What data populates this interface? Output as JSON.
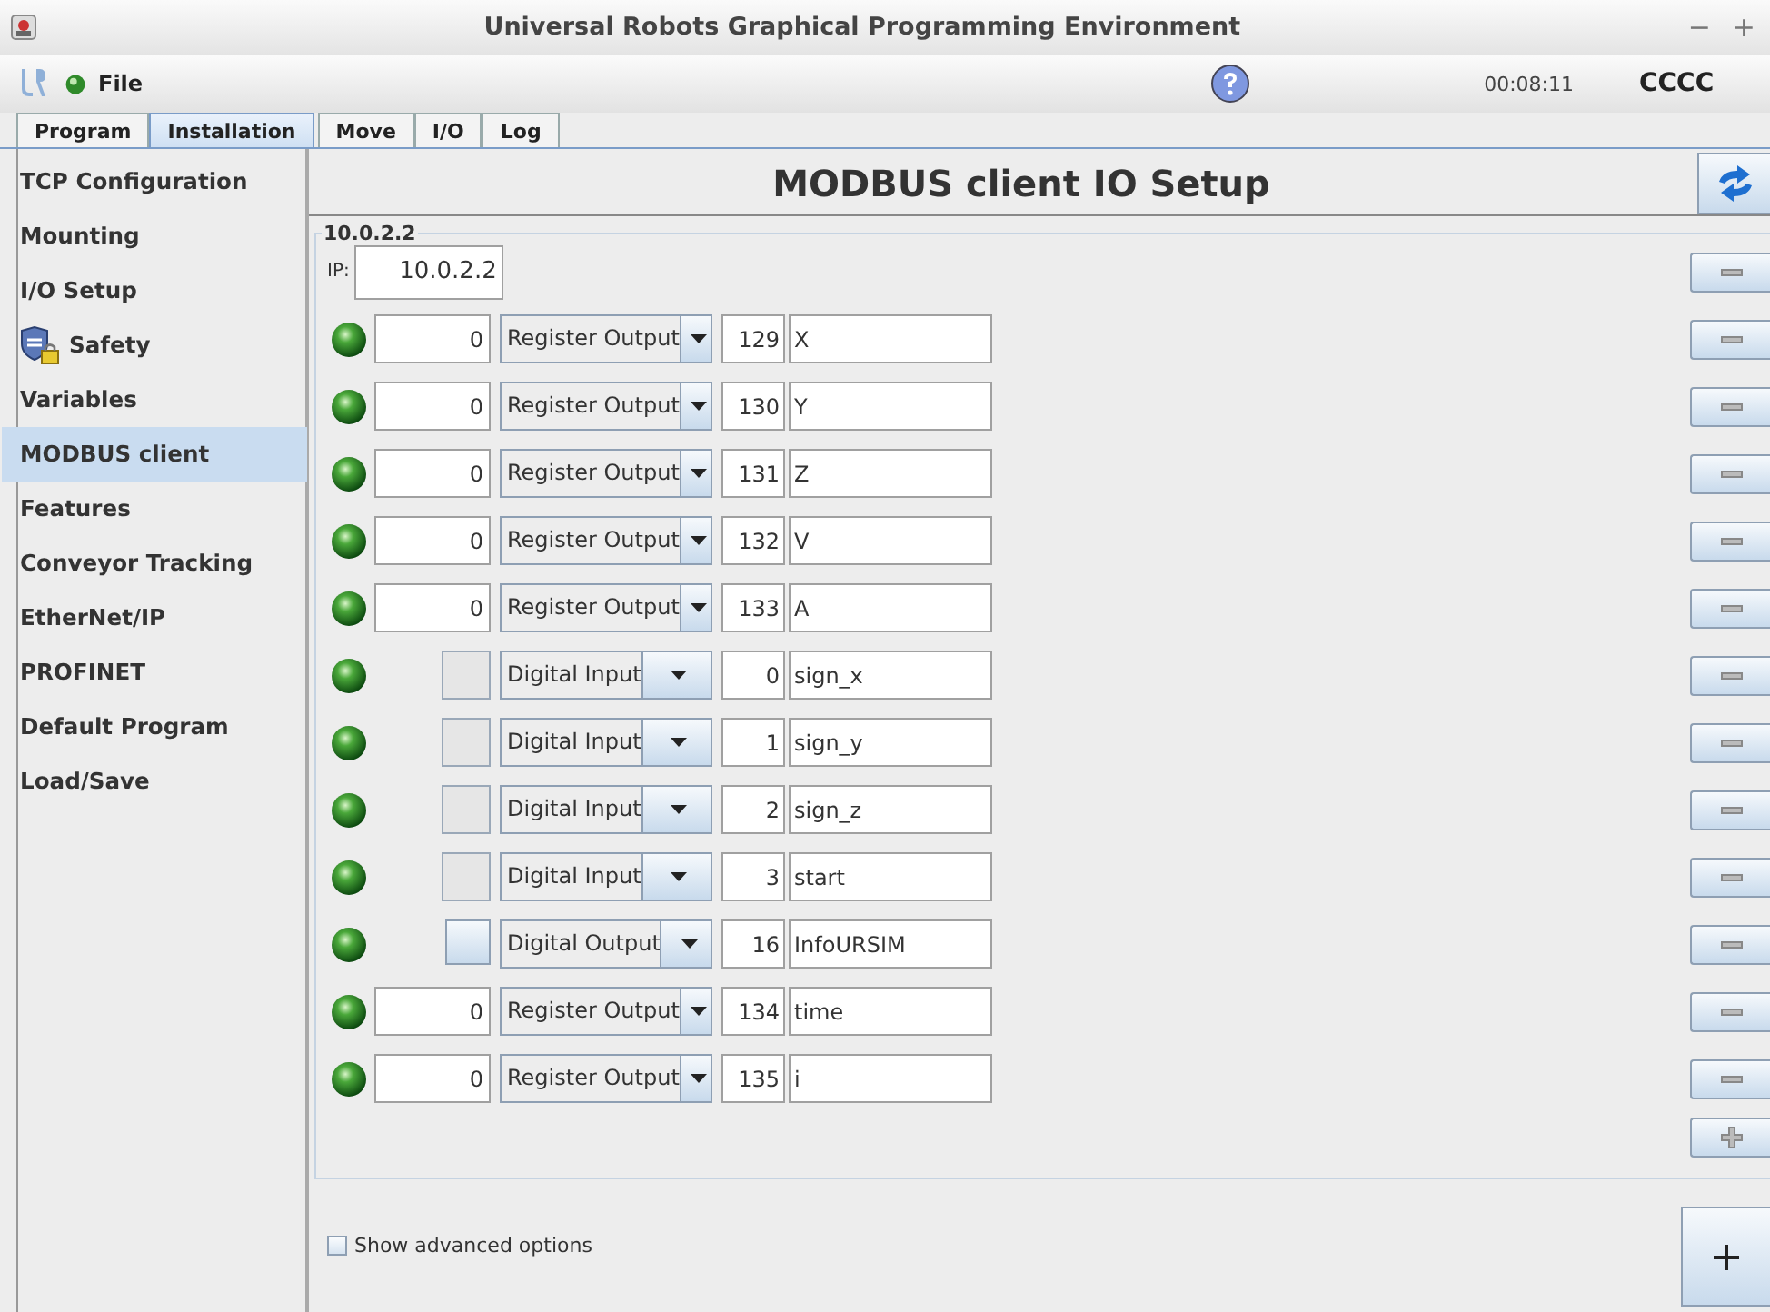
{
  "window": {
    "title": "Universal Robots Graphical Programming Environment",
    "controls": [
      "−",
      "+"
    ]
  },
  "menubar": {
    "menu": "File",
    "time": "00:08:11",
    "robot_name": "CCCC"
  },
  "tabs": [
    {
      "label": "Program",
      "selected": false
    },
    {
      "label": "Installation",
      "selected": true
    },
    {
      "label": "Move",
      "selected": false
    },
    {
      "label": "I/O",
      "selected": false
    },
    {
      "label": "Log",
      "selected": false
    }
  ],
  "sidebar": {
    "items": [
      {
        "label": "TCP Configuration",
        "selected": false,
        "locked": false
      },
      {
        "label": "Mounting",
        "selected": false,
        "locked": false
      },
      {
        "label": "I/O Setup",
        "selected": false,
        "locked": false
      },
      {
        "label": "Safety",
        "selected": false,
        "locked": true
      },
      {
        "label": "Variables",
        "selected": false,
        "locked": false
      },
      {
        "label": "MODBUS client",
        "selected": true,
        "locked": false
      },
      {
        "label": "Features",
        "selected": false,
        "locked": false
      },
      {
        "label": "Conveyor Tracking",
        "selected": false,
        "locked": false
      },
      {
        "label": "EtherNet/IP",
        "selected": false,
        "locked": false
      },
      {
        "label": "PROFINET",
        "selected": false,
        "locked": false
      },
      {
        "label": "Default Program",
        "selected": false,
        "locked": false
      },
      {
        "label": "Load/Save",
        "selected": false,
        "locked": false
      }
    ]
  },
  "panel": {
    "title": "MODBUS client IO Setup",
    "unit": {
      "legend": "10.0.2.2",
      "ip_label": "IP:",
      "ip": "10.0.2.2",
      "signals": [
        {
          "kind": "register",
          "value": "0",
          "type": "Register Output",
          "address": "129",
          "name": "X"
        },
        {
          "kind": "register",
          "value": "0",
          "type": "Register Output",
          "address": "130",
          "name": "Y"
        },
        {
          "kind": "register",
          "value": "0",
          "type": "Register Output",
          "address": "131",
          "name": "Z"
        },
        {
          "kind": "register",
          "value": "0",
          "type": "Register Output",
          "address": "132",
          "name": "V"
        },
        {
          "kind": "register",
          "value": "0",
          "type": "Register Output",
          "address": "133",
          "name": "A"
        },
        {
          "kind": "digital_in",
          "type": "Digital Input",
          "address": "0",
          "name": "sign_x"
        },
        {
          "kind": "digital_in",
          "type": "Digital Input",
          "address": "1",
          "name": "sign_y"
        },
        {
          "kind": "digital_in",
          "type": "Digital Input",
          "address": "2",
          "name": "sign_z"
        },
        {
          "kind": "digital_in",
          "type": "Digital Input",
          "address": "3",
          "name": "start"
        },
        {
          "kind": "digital_out",
          "type": "Digital Output",
          "address": "16",
          "name": "InfoURSIM"
        },
        {
          "kind": "register",
          "value": "0",
          "type": "Register Output",
          "address": "134",
          "name": "time"
        },
        {
          "kind": "register",
          "value": "0",
          "type": "Register Output",
          "address": "135",
          "name": "i"
        }
      ]
    },
    "advanced": {
      "label": "Show advanced options",
      "checked": false
    }
  }
}
